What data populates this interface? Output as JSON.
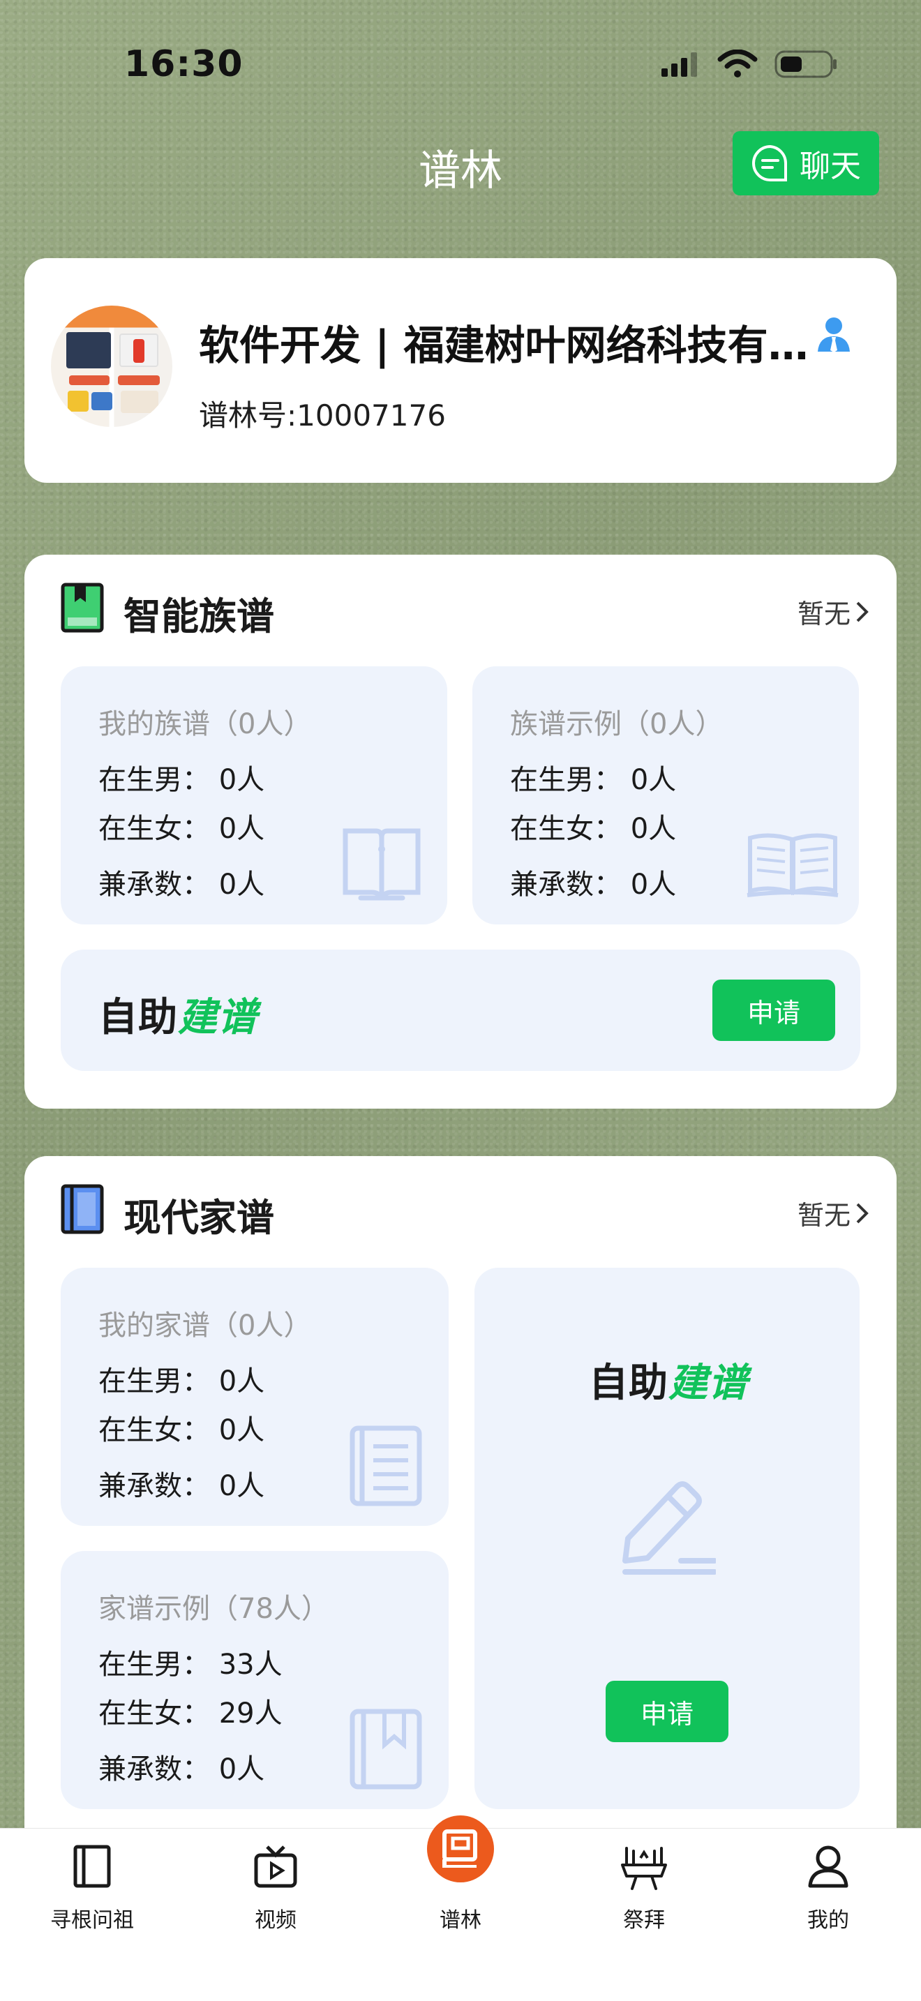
{
  "status": {
    "time": "16:30"
  },
  "header": {
    "title": "谱林",
    "chat_label": "聊天"
  },
  "profile": {
    "name": "软件开发 | 福建树叶网络科技有限公司",
    "id_text": "谱林号:10007176"
  },
  "smart_genealogy": {
    "title": "智能族谱",
    "more_label": "暂无",
    "my_box": {
      "heading": "我的族谱（0人）",
      "male": "在生男：  0人",
      "female": "在生女：  0人",
      "inherit": "兼承数：  0人"
    },
    "example_box": {
      "heading": "族谱示例（0人）",
      "male": "在生男：  0人",
      "female": "在生女：  0人",
      "inherit": "兼承数：  0人"
    },
    "build": {
      "logo_part1": "自助",
      "logo_part2": "建谱",
      "apply_label": "申请"
    }
  },
  "modern_genealogy": {
    "title": "现代家谱",
    "more_label": "暂无",
    "my_box": {
      "heading": "我的家谱（0人）",
      "male": "在生男：  0人",
      "female": "在生女：  0人",
      "inherit": "兼承数：  0人"
    },
    "example_box": {
      "heading": "家谱示例（78人）",
      "male": "在生男：  33人",
      "female": "在生女：  29人",
      "inherit": "兼承数：  0人"
    },
    "build": {
      "logo_part1": "自助",
      "logo_part2": "建谱",
      "apply_label": "申请"
    }
  },
  "tabbar": {
    "items": [
      {
        "label": "寻根问祖",
        "icon": "book-icon"
      },
      {
        "label": "视频",
        "icon": "tv-icon"
      },
      {
        "label": "谱林",
        "icon": "pulin-logo-icon"
      },
      {
        "label": "祭拜",
        "icon": "worship-icon"
      },
      {
        "label": "我的",
        "icon": "user-icon"
      }
    ]
  },
  "colors": {
    "accent": "#11c25a",
    "box_bg": "#eef3fc",
    "logo_orange": "#ec5a1d"
  }
}
